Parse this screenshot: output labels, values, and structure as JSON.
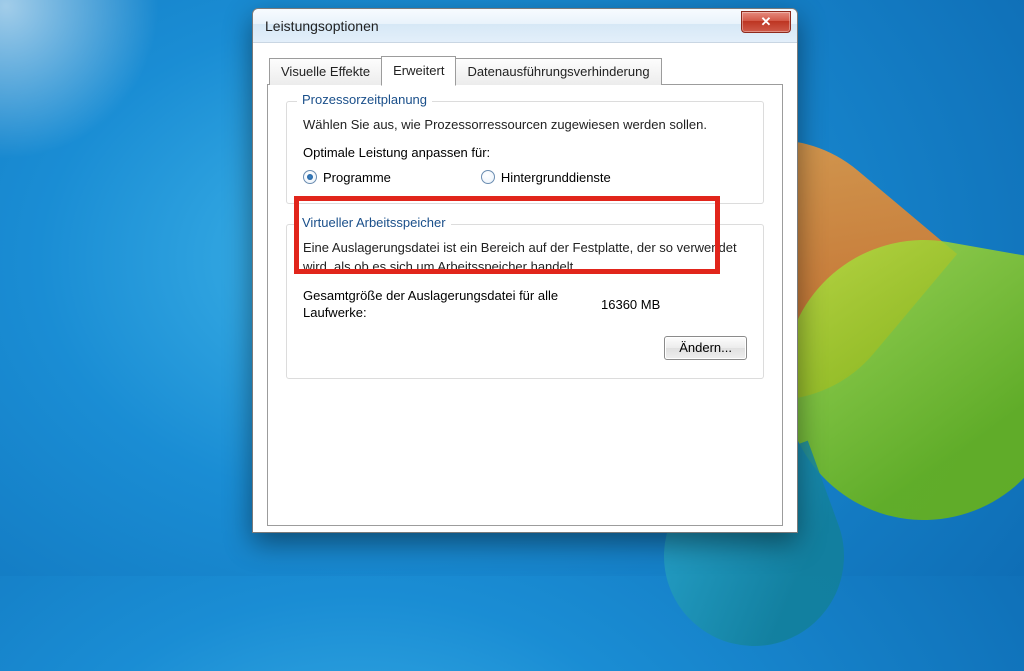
{
  "window": {
    "title": "Leistungsoptionen"
  },
  "tabs": {
    "visual": "Visuelle Effekte",
    "advanced": "Erweitert",
    "dep": "Datenausführungsverhinderung"
  },
  "processor": {
    "legend": "Prozessorzeitplanung",
    "desc": "Wählen Sie aus, wie Prozessorressourcen zugewiesen werden sollen.",
    "adjust_label": "Optimale Leistung anpassen für:",
    "option_programs": "Programme",
    "option_background": "Hintergrunddienste",
    "selected": "programs"
  },
  "virtual_memory": {
    "legend": "Virtueller Arbeitsspeicher",
    "desc": "Eine Auslagerungsdatei ist ein Bereich auf der Festplatte, der so verwendet wird, als ob es sich um Arbeitsspeicher handelt.",
    "total_label": "Gesamtgröße der Auslagerungsdatei für alle Laufwerke:",
    "total_value": "16360 MB",
    "change_button": "Ändern..."
  }
}
